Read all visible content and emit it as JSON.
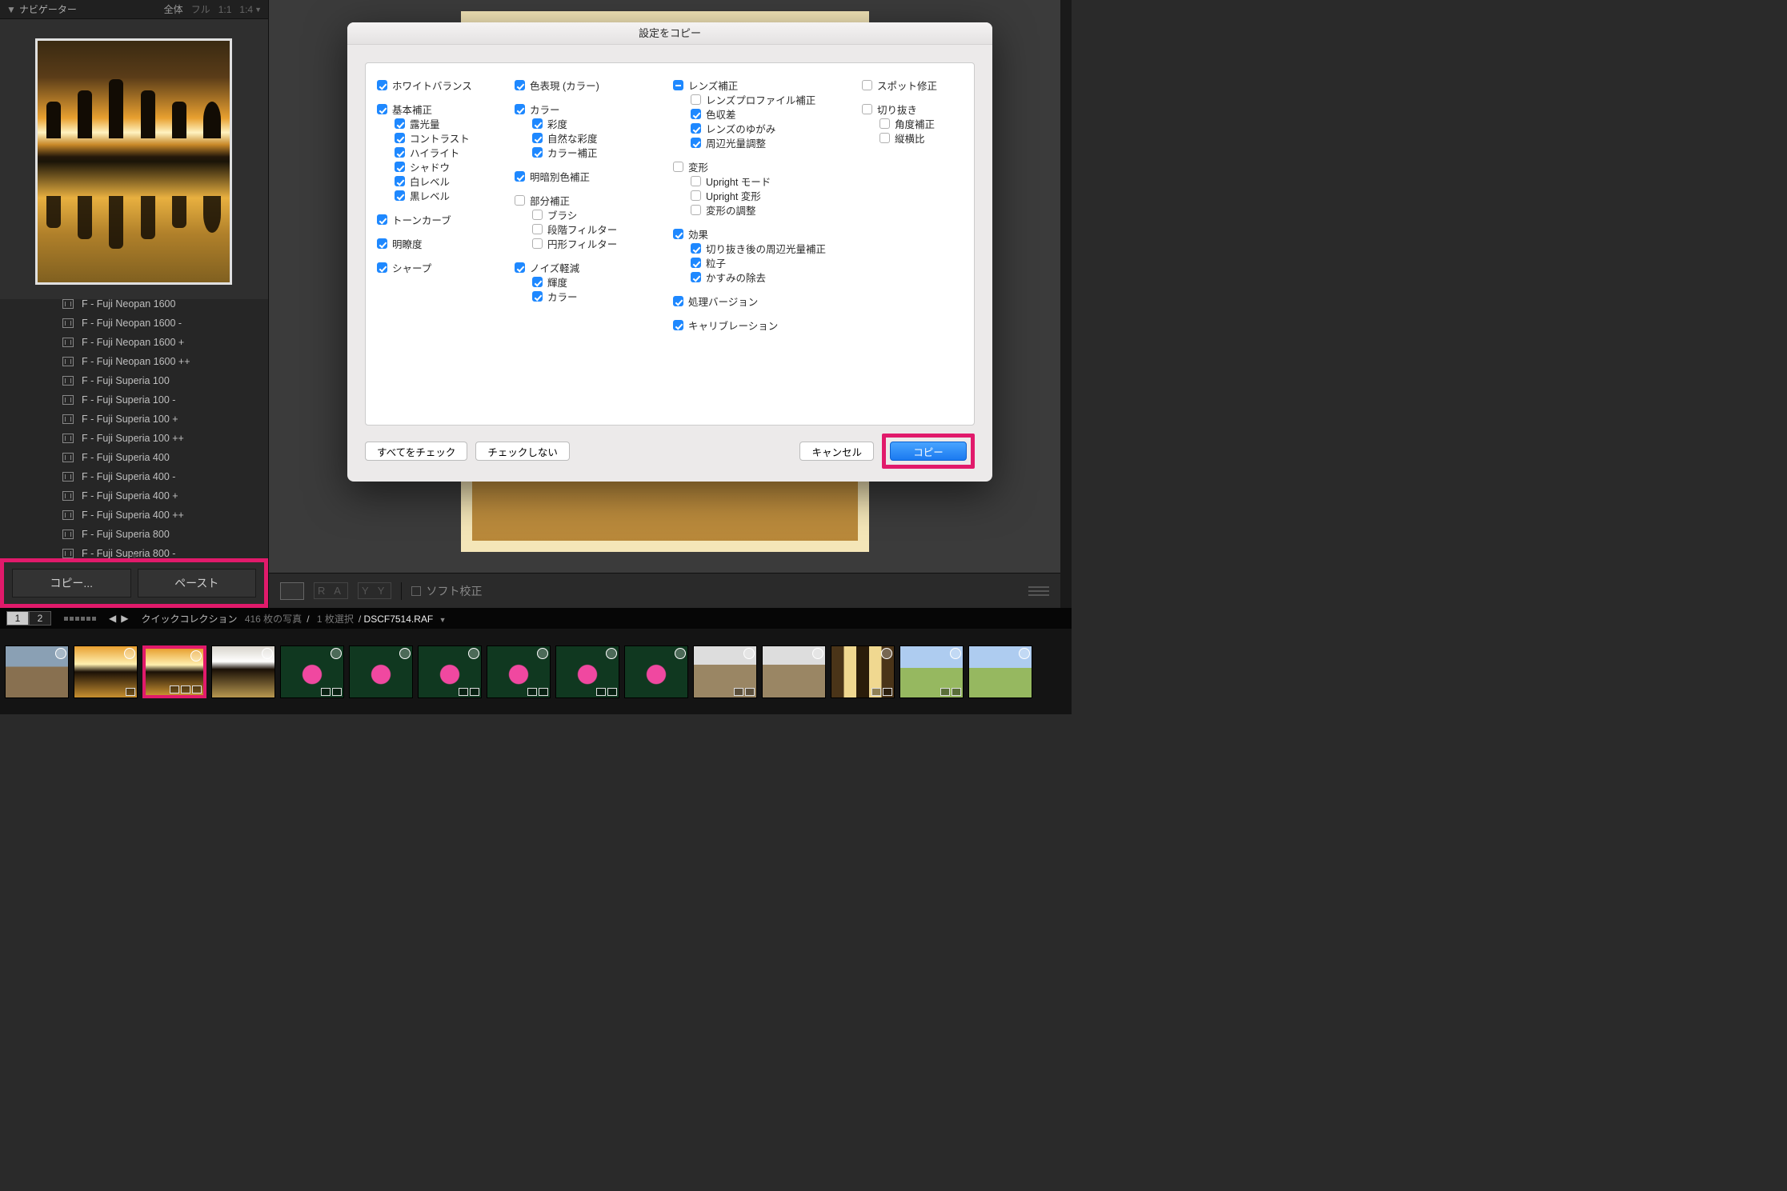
{
  "navigator": {
    "title": "ナビゲーター",
    "zooms": [
      "全体",
      "フル",
      "1:1",
      "1:4"
    ]
  },
  "presets": [
    "F - Fuji Neopan 1600",
    "F - Fuji Neopan 1600 -",
    "F - Fuji Neopan 1600 +",
    "F - Fuji Neopan 1600 ++",
    "F - Fuji Superia 100",
    "F - Fuji Superia 100 -",
    "F - Fuji Superia 100 +",
    "F - Fuji Superia 100 ++",
    "F - Fuji Superia 400",
    "F - Fuji Superia 400 -",
    "F - Fuji Superia 400 +",
    "F - Fuji Superia 400 ++",
    "F - Fuji Superia 800",
    "F - Fuji Superia 800 -"
  ],
  "left_buttons": {
    "copy": "コピー...",
    "paste": "ペースト"
  },
  "toolbar": {
    "soft_proof": "ソフト校正"
  },
  "filmstrip_header": {
    "pages": [
      "1",
      "2"
    ],
    "collection": "クイックコレクション",
    "count": "416 枚の写真",
    "selection": "1 枚選択",
    "file": "DSCF7514.RAF"
  },
  "thumbs": [
    {
      "cls": "tfill-crowd",
      "sel": false,
      "icons": 0
    },
    {
      "cls": "tfill-sunrise",
      "sel": false,
      "icons": 1
    },
    {
      "cls": "tfill-sunrise",
      "sel": true,
      "icons": 3
    },
    {
      "cls": "tfill-reflect",
      "sel": false,
      "icons": 0
    },
    {
      "cls": "tfill-lotus",
      "sel": false,
      "icons": 2
    },
    {
      "cls": "tfill-lotus",
      "sel": false,
      "icons": 0
    },
    {
      "cls": "tfill-lotus",
      "sel": false,
      "icons": 2
    },
    {
      "cls": "tfill-lotus",
      "sel": false,
      "icons": 2
    },
    {
      "cls": "tfill-lotus",
      "sel": false,
      "icons": 2
    },
    {
      "cls": "tfill-lotus",
      "sel": false,
      "icons": 0
    },
    {
      "cls": "tfill-ruin",
      "sel": false,
      "icons": 2
    },
    {
      "cls": "tfill-ruin",
      "sel": false,
      "icons": 0
    },
    {
      "cls": "tfill-corridor",
      "sel": false,
      "icons": 2
    },
    {
      "cls": "tfill-field",
      "sel": false,
      "icons": 2
    },
    {
      "cls": "tfill-field",
      "sel": false,
      "icons": 0
    }
  ],
  "dialog": {
    "title": "設定をコピー",
    "actions": {
      "check_all": "すべてをチェック",
      "check_none": "チェックしない",
      "cancel": "キャンセル",
      "copy": "コピー"
    },
    "columns": [
      [
        {
          "type": "group",
          "head": {
            "label": "ホワイトバランス",
            "state": "on"
          }
        },
        {
          "type": "group",
          "head": {
            "label": "基本補正",
            "state": "on"
          },
          "children": [
            {
              "label": "露光量",
              "state": "on"
            },
            {
              "label": "コントラスト",
              "state": "on"
            },
            {
              "label": "ハイライト",
              "state": "on"
            },
            {
              "label": "シャドウ",
              "state": "on"
            },
            {
              "label": "白レベル",
              "state": "on"
            },
            {
              "label": "黒レベル",
              "state": "on"
            }
          ]
        },
        {
          "type": "group",
          "head": {
            "label": "トーンカーブ",
            "state": "on"
          }
        },
        {
          "type": "group",
          "head": {
            "label": "明瞭度",
            "state": "on"
          }
        },
        {
          "type": "group",
          "head": {
            "label": "シャープ",
            "state": "on"
          }
        }
      ],
      [
        {
          "type": "group",
          "head": {
            "label": "色表現 (カラー)",
            "state": "on"
          }
        },
        {
          "type": "group",
          "head": {
            "label": "カラー",
            "state": "on"
          },
          "children": [
            {
              "label": "彩度",
              "state": "on"
            },
            {
              "label": "自然な彩度",
              "state": "on"
            },
            {
              "label": "カラー補正",
              "state": "on"
            }
          ]
        },
        {
          "type": "group",
          "head": {
            "label": "明暗別色補正",
            "state": "on"
          }
        },
        {
          "type": "group",
          "head": {
            "label": "部分補正",
            "state": "off"
          },
          "children": [
            {
              "label": "ブラシ",
              "state": "off"
            },
            {
              "label": "段階フィルター",
              "state": "off"
            },
            {
              "label": "円形フィルター",
              "state": "off"
            }
          ]
        },
        {
          "type": "group",
          "head": {
            "label": "ノイズ軽減",
            "state": "on"
          },
          "children": [
            {
              "label": "輝度",
              "state": "on"
            },
            {
              "label": "カラー",
              "state": "on"
            }
          ]
        }
      ],
      [
        {
          "type": "group",
          "head": {
            "label": "レンズ補正",
            "state": "mixed"
          },
          "children": [
            {
              "label": "レンズプロファイル補正",
              "state": "off"
            },
            {
              "label": "色収差",
              "state": "on"
            },
            {
              "label": "レンズのゆがみ",
              "state": "on"
            },
            {
              "label": "周辺光量調整",
              "state": "on"
            }
          ]
        },
        {
          "type": "group",
          "head": {
            "label": "変形",
            "state": "off"
          },
          "children": [
            {
              "label": "Upright モード",
              "state": "off"
            },
            {
              "label": "Upright 変形",
              "state": "off"
            },
            {
              "label": "変形の調整",
              "state": "off"
            }
          ]
        },
        {
          "type": "group",
          "head": {
            "label": "効果",
            "state": "on"
          },
          "children": [
            {
              "label": "切り抜き後の周辺光量補正",
              "state": "on"
            },
            {
              "label": "粒子",
              "state": "on"
            },
            {
              "label": "かすみの除去",
              "state": "on"
            }
          ]
        },
        {
          "type": "group",
          "head": {
            "label": "処理バージョン",
            "state": "on"
          }
        },
        {
          "type": "group",
          "head": {
            "label": "キャリブレーション",
            "state": "on"
          }
        }
      ],
      [
        {
          "type": "group",
          "head": {
            "label": "スポット修正",
            "state": "off"
          }
        },
        {
          "type": "group",
          "head": {
            "label": "切り抜き",
            "state": "off"
          },
          "children": [
            {
              "label": "角度補正",
              "state": "off"
            },
            {
              "label": "縦横比",
              "state": "off"
            }
          ]
        }
      ]
    ]
  }
}
